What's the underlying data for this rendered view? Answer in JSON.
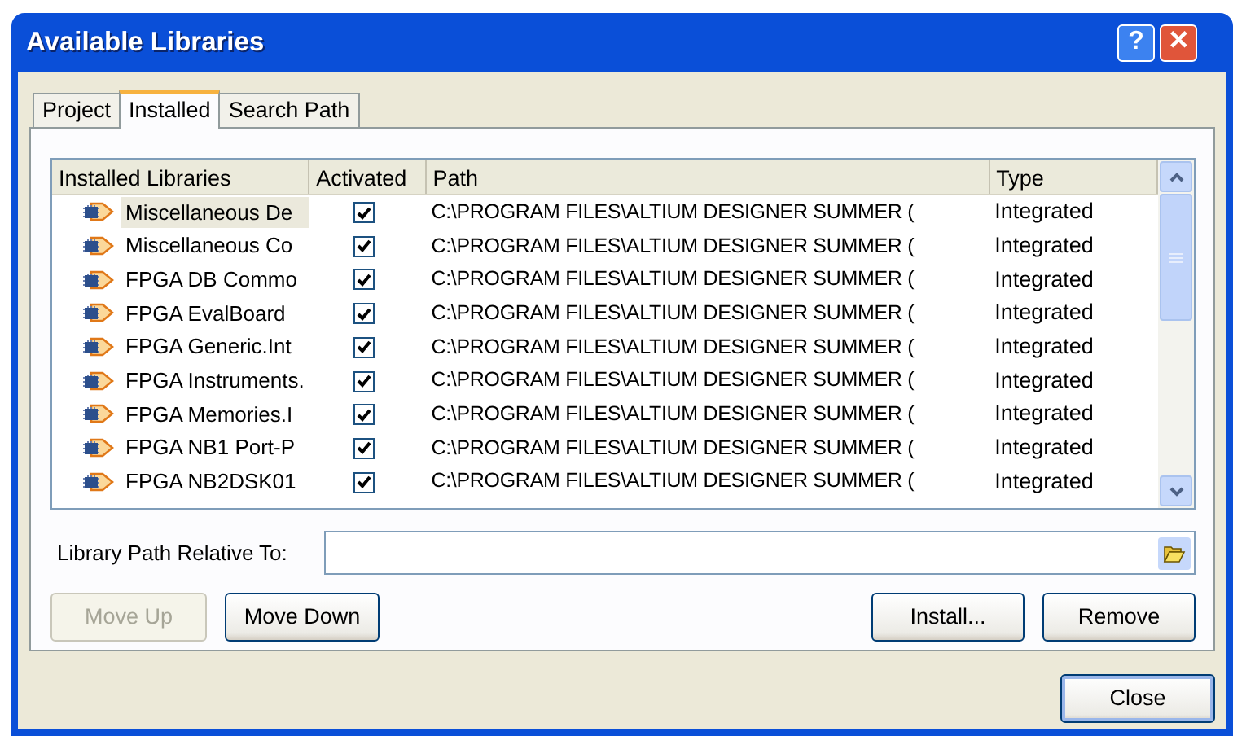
{
  "window": {
    "title": "Available Libraries",
    "help_button": "?",
    "close_button": "✕"
  },
  "tabs": [
    {
      "label": "Project",
      "selected": false
    },
    {
      "label": "Installed",
      "selected": true
    },
    {
      "label": "Search Path",
      "selected": false
    }
  ],
  "table": {
    "columns": [
      "Installed Libraries",
      "Activated",
      "Path",
      "Type"
    ],
    "rows": [
      {
        "name": "Miscellaneous De",
        "activated": true,
        "path": "C:\\PROGRAM FILES\\ALTIUM DESIGNER SUMMER (",
        "type": "Integrated",
        "selected": true
      },
      {
        "name": "Miscellaneous Co",
        "activated": true,
        "path": "C:\\PROGRAM FILES\\ALTIUM DESIGNER SUMMER (",
        "type": "Integrated",
        "selected": false
      },
      {
        "name": "FPGA DB Commo",
        "activated": true,
        "path": "C:\\PROGRAM FILES\\ALTIUM DESIGNER SUMMER (",
        "type": "Integrated",
        "selected": false
      },
      {
        "name": "FPGA EvalBoard",
        "activated": true,
        "path": "C:\\PROGRAM FILES\\ALTIUM DESIGNER SUMMER (",
        "type": "Integrated",
        "selected": false
      },
      {
        "name": "FPGA Generic.Int",
        "activated": true,
        "path": "C:\\PROGRAM FILES\\ALTIUM DESIGNER SUMMER (",
        "type": "Integrated",
        "selected": false
      },
      {
        "name": "FPGA Instruments.",
        "activated": true,
        "path": "C:\\PROGRAM FILES\\ALTIUM DESIGNER SUMMER (",
        "type": "Integrated",
        "selected": false
      },
      {
        "name": "FPGA Memories.I",
        "activated": true,
        "path": "C:\\PROGRAM FILES\\ALTIUM DESIGNER SUMMER (",
        "type": "Integrated",
        "selected": false
      },
      {
        "name": "FPGA NB1 Port-P",
        "activated": true,
        "path": "C:\\PROGRAM FILES\\ALTIUM DESIGNER SUMMER (",
        "type": "Integrated",
        "selected": false
      },
      {
        "name": "FPGA NB2DSK01",
        "activated": true,
        "path": "C:\\PROGRAM FILES\\ALTIUM DESIGNER SUMMER (",
        "type": "Integrated",
        "selected": false
      }
    ]
  },
  "path_relative": {
    "label": "Library Path Relative To:"
  },
  "buttons": [
    {
      "label": "Move Up",
      "disabled": true
    },
    {
      "label": "Move Down",
      "disabled": false
    },
    {
      "label": "Install...",
      "disabled": false
    },
    {
      "label": "Remove",
      "disabled": false
    }
  ],
  "close": {
    "label": "Close"
  }
}
